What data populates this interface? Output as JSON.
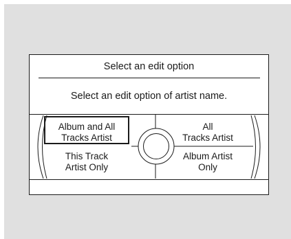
{
  "dialog": {
    "title": "Select an edit option",
    "message": "Select an edit option of artist name."
  },
  "options": {
    "top_left": {
      "line1": "Album and All",
      "line2": "Tracks Artist",
      "selected": true
    },
    "top_right": {
      "line1": "All",
      "line2": "Tracks Artist",
      "selected": false
    },
    "bottom_left": {
      "line1": "This Track",
      "line2": "Artist Only",
      "selected": false
    },
    "bottom_right": {
      "line1": "Album Artist",
      "line2": "Only",
      "selected": false
    }
  },
  "icons": {
    "center": "interface-dial-icon"
  }
}
